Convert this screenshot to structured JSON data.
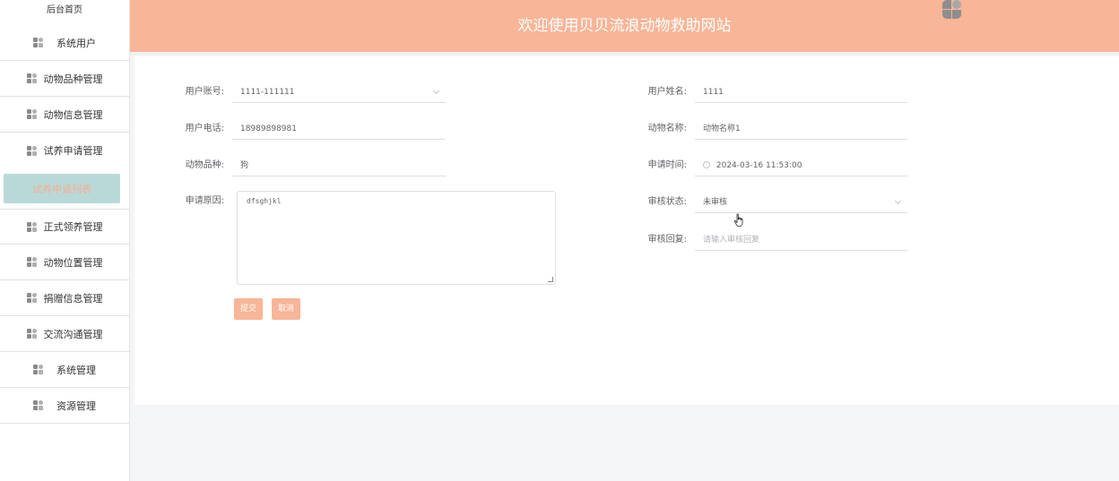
{
  "sidebar": {
    "home": "后台首页",
    "items": [
      {
        "label": "系统用户"
      },
      {
        "label": "动物品种管理"
      },
      {
        "label": "动物信息管理"
      },
      {
        "label": "试养申请管理"
      },
      {
        "label": "试养申请列表"
      },
      {
        "label": "正式领养管理"
      },
      {
        "label": "动物位置管理"
      },
      {
        "label": "捐赠信息管理"
      },
      {
        "label": "交流沟通管理"
      },
      {
        "label": "系统管理"
      },
      {
        "label": "资源管理"
      }
    ]
  },
  "header": {
    "title": "欢迎使用贝贝流浪动物救助网站",
    "avatar_icon": "user-avatar-icon"
  },
  "form": {
    "user_account": {
      "label": "用户账号:",
      "value": "1111-111111"
    },
    "user_name": {
      "label": "用户姓名:",
      "value": "1111"
    },
    "user_phone": {
      "label": "用户电话:",
      "value": "18989898981"
    },
    "animal_name": {
      "label": "动物名称:",
      "value": "动物名称1"
    },
    "animal_breed": {
      "label": "动物品种:",
      "value": "狗"
    },
    "apply_time": {
      "label": "申请时间:",
      "value": "2024-03-16 11:53:00"
    },
    "apply_reason": {
      "label": "申请原因:",
      "value": "dfsghjkl"
    },
    "review_status": {
      "label": "审核状态:",
      "value": "未审核"
    },
    "review_reply": {
      "label": "审核回复:",
      "placeholder": "请输入审核回复"
    }
  },
  "buttons": {
    "submit": "提交",
    "cancel": "取消"
  },
  "colors": {
    "header_bg": "#f8b597",
    "active_nav_bg": "#b9d9d9",
    "active_nav_text": "#f6ae8e",
    "button_bg": "#f8b597"
  }
}
